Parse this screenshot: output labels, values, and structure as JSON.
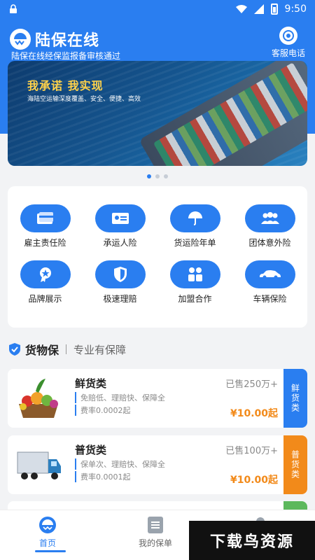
{
  "status_bar": {
    "time": "9:50"
  },
  "header": {
    "app_name": "陆保在线",
    "subtitle": "陆保在线经保监报备审核通过",
    "service_label": "客服电话"
  },
  "banner": {
    "headline": "我承诺  我实现",
    "tagline": "海陆空运输深度覆盖、安全、便捷、高效"
  },
  "services": [
    {
      "label": "雇主责任险",
      "icon": "card-icon"
    },
    {
      "label": "承运人险",
      "icon": "id-card-icon"
    },
    {
      "label": "货运险年单",
      "icon": "umbrella-icon"
    },
    {
      "label": "团体意外险",
      "icon": "group-icon"
    },
    {
      "label": "品牌展示",
      "icon": "badge-icon"
    },
    {
      "label": "极速理赔",
      "icon": "shield-icon"
    },
    {
      "label": "加盟合作",
      "icon": "partner-icon"
    },
    {
      "label": "车辆保险",
      "icon": "car-icon"
    }
  ],
  "section": {
    "title": "货物保",
    "subtitle": "专业有保障"
  },
  "products": [
    {
      "name": "鲜货类",
      "sold": "已售250万+",
      "feature1": "免赔低、理赔快、保障全",
      "feature2": "费率0.0002起",
      "price": "¥10.00起",
      "tag": "鲜货类",
      "tag_color": "#2a7ef0"
    },
    {
      "name": "普货类",
      "sold": "已售100万+",
      "feature1": "保单次、理赔快、保障全",
      "feature2": "费率0.0001起",
      "price": "¥10.00起",
      "tag": "普货类",
      "tag_color": "#f28a1a"
    }
  ],
  "bottom_nav": [
    {
      "label": "首页"
    },
    {
      "label": "我的保单"
    }
  ],
  "watermark": "下载鸟资源",
  "colors": {
    "primary": "#2a7ef0",
    "accent": "#f28a1a",
    "green_tag": "#5cb85c"
  }
}
